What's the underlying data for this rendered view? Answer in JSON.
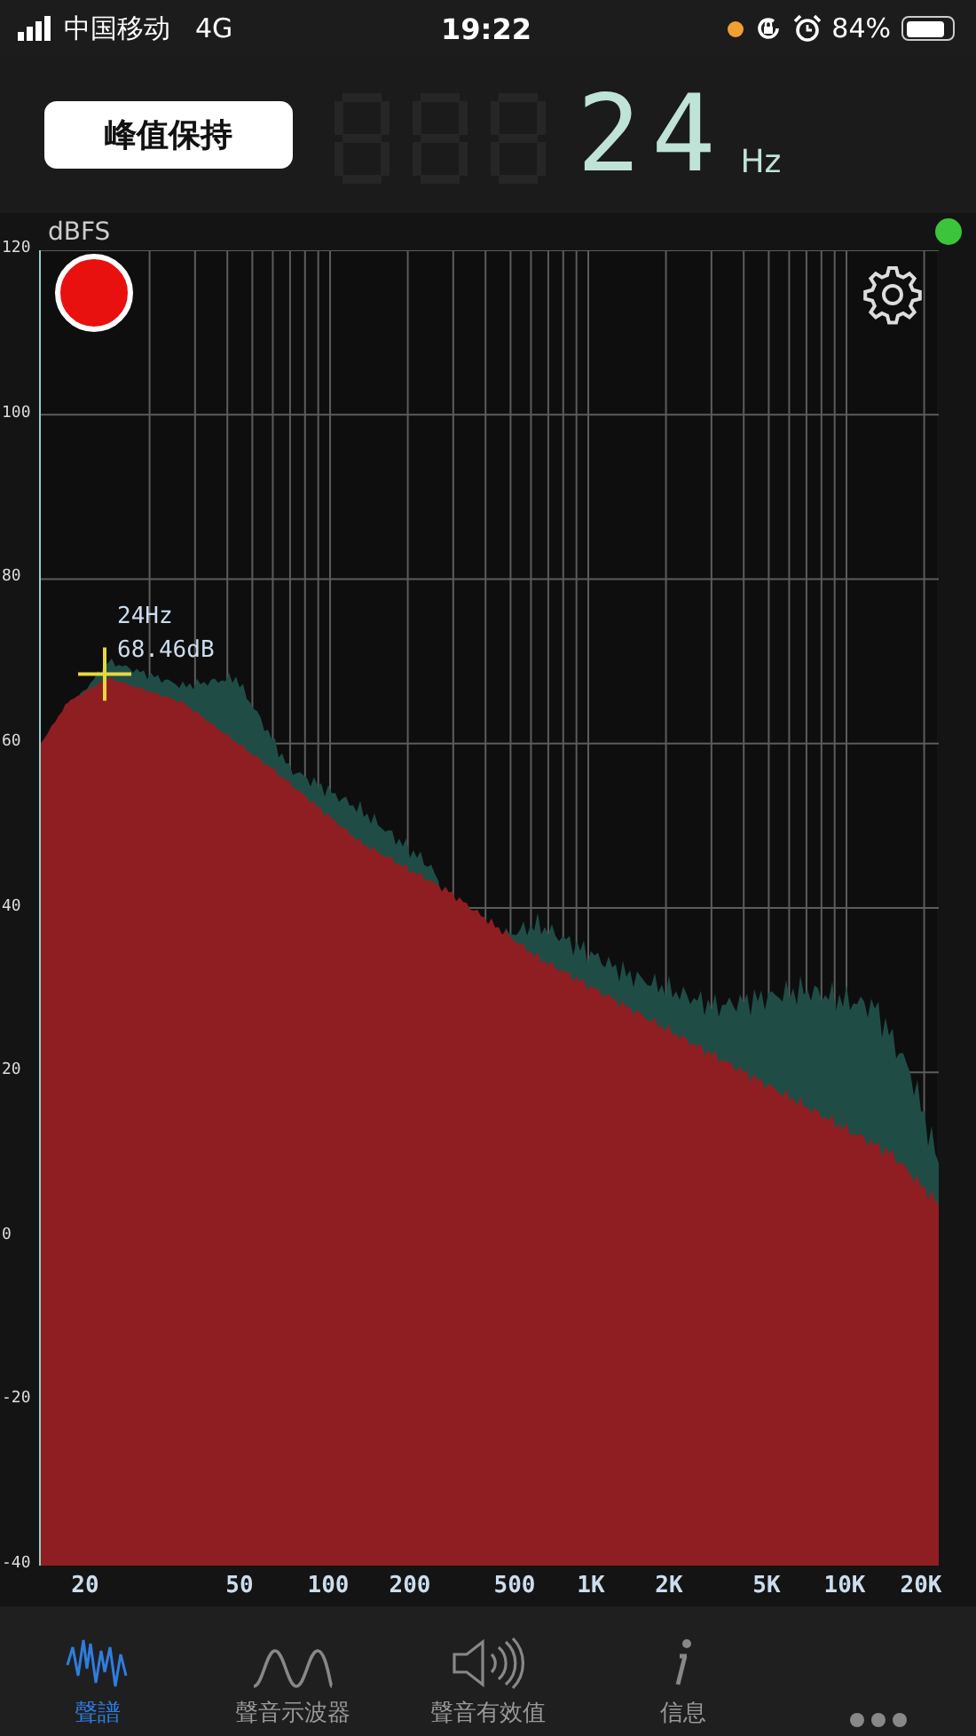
{
  "status_bar": {
    "carrier": "中国移动",
    "network": "4G",
    "time": "19:22",
    "battery": "84%"
  },
  "hold_button": "峰值保持",
  "readout": {
    "value": "24",
    "unit": "Hz"
  },
  "chart": {
    "y_unit": "dBFS",
    "y_labels": [
      "120",
      "100",
      "80",
      "60",
      "40",
      "20",
      "0",
      "-20",
      "-40"
    ],
    "x_labels": [
      "20",
      "50",
      "100",
      "200",
      "500",
      "1K",
      "2K",
      "5K",
      "10K",
      "20K"
    ],
    "marker": {
      "freq": "24Hz",
      "level": "68.46dB"
    }
  },
  "tabs": [
    {
      "kind": "spectrum",
      "label": "聲譜",
      "selected": true
    },
    {
      "kind": "oscilloscope",
      "label": "聲音示波器",
      "selected": false
    },
    {
      "kind": "rms",
      "label": "聲音有效值",
      "selected": false
    },
    {
      "kind": "info",
      "label": "信息",
      "selected": false
    },
    {
      "kind": "more",
      "selected": false
    }
  ]
}
